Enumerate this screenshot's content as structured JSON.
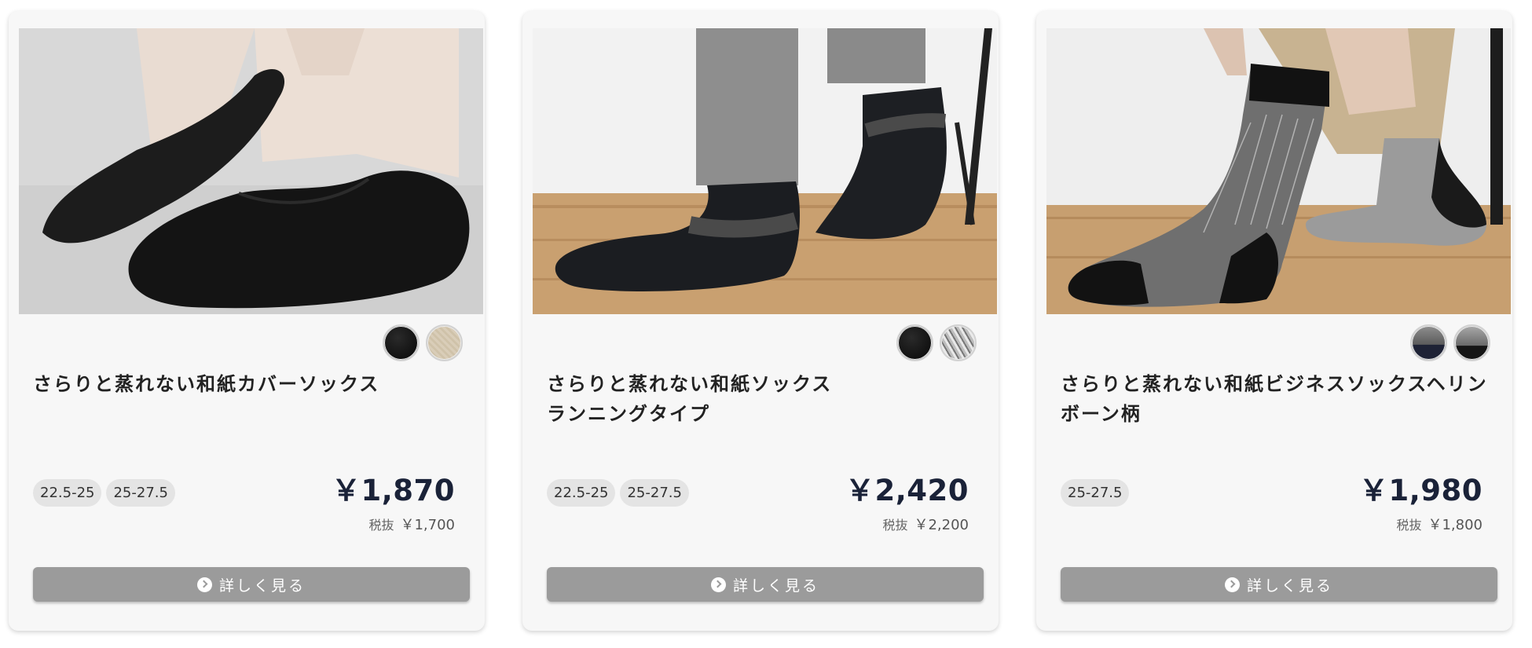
{
  "colors": {
    "card_bg": "#f7f7f7",
    "price": "#1a2238",
    "button_bg": "#9b9b9b",
    "size_tag_bg": "#e4e4e4"
  },
  "products": [
    {
      "title": "さらりと蒸れない和紙カバーソックス",
      "image": "black-cover-socks-photo",
      "swatches": [
        "black",
        "beige"
      ],
      "sizes": [
        "22.5-25",
        "25-27.5"
      ],
      "price": "￥1,870",
      "tax_label": "税抜",
      "tax_price": "￥1,700",
      "button_label": "詳しく見る",
      "button_icon": "chevron-right-circle-icon"
    },
    {
      "title": "さらりと蒸れない和紙ソックス\nランニングタイプ",
      "image": "running-socks-photo",
      "swatches": [
        "black",
        "grey-mix"
      ],
      "sizes": [
        "22.5-25",
        "25-27.5"
      ],
      "price": "￥2,420",
      "tax_label": "税抜",
      "tax_price": "￥2,200",
      "button_label": "詳しく見る",
      "button_icon": "chevron-right-circle-icon"
    },
    {
      "title": "さらりと蒸れない和紙ビジネスソックスヘリンボーン柄",
      "image": "herringbone-business-socks-photo",
      "swatches": [
        "navy",
        "black-hb"
      ],
      "sizes": [
        "25-27.5"
      ],
      "price": "￥1,980",
      "tax_label": "税抜",
      "tax_price": "￥1,800",
      "button_label": "詳しく見る",
      "button_icon": "chevron-right-circle-icon"
    }
  ]
}
